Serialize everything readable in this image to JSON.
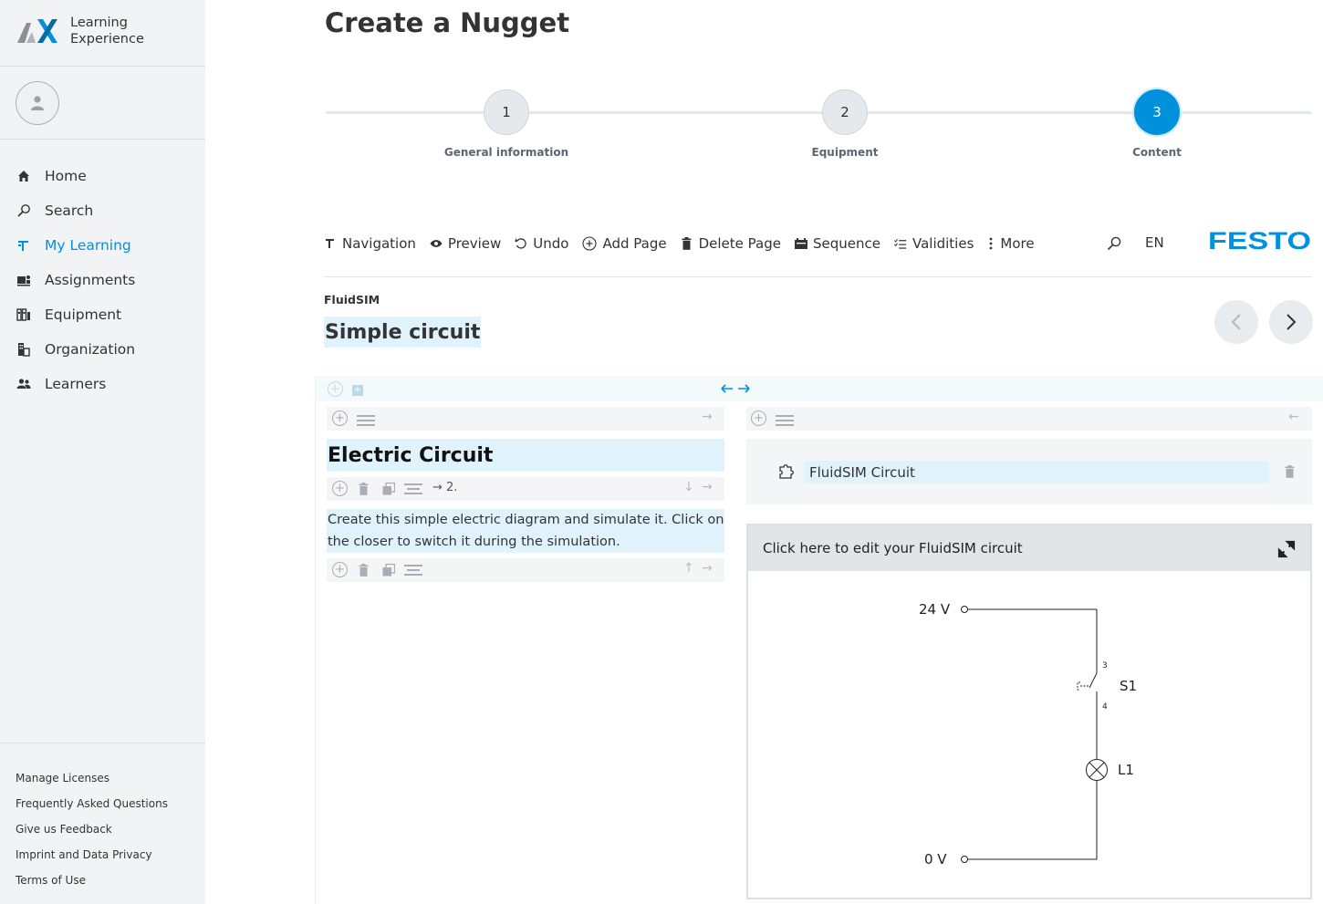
{
  "app": {
    "brand_line1": "Learning",
    "brand_line2": "Experience"
  },
  "nav": [
    {
      "label": "Home",
      "icon": "home-icon",
      "active": false
    },
    {
      "label": "Search",
      "icon": "search-icon",
      "active": false
    },
    {
      "label": "My Learning",
      "icon": "my-learning-icon",
      "active": true
    },
    {
      "label": "Assignments",
      "icon": "assignments-icon",
      "active": false
    },
    {
      "label": "Equipment",
      "icon": "equipment-icon",
      "active": false
    },
    {
      "label": "Organization",
      "icon": "organization-icon",
      "active": false
    },
    {
      "label": "Learners",
      "icon": "learners-icon",
      "active": false
    }
  ],
  "footer_links": [
    "Manage Licenses",
    "Frequently Asked Questions",
    "Give us Feedback",
    "Imprint and Data Privacy",
    "Terms of Use"
  ],
  "page": {
    "title": "Create a Nugget"
  },
  "steps": [
    {
      "number": "1",
      "label": "General information",
      "active": false
    },
    {
      "number": "2",
      "label": "Equipment",
      "active": false
    },
    {
      "number": "3",
      "label": "Content",
      "active": true
    }
  ],
  "toolbar": {
    "navigation": "Navigation",
    "preview": "Preview",
    "undo": "Undo",
    "add_page": "Add Page",
    "delete_page": "Delete Page",
    "sequence": "Sequence",
    "validities": "Validities",
    "more": "More",
    "language": "EN",
    "logo_text": "FESTO"
  },
  "nugget": {
    "breadcrumb": "FluidSIM",
    "title": "Simple circuit"
  },
  "left_column": {
    "heading": "Electric Circuit",
    "numbering": "→ 2.",
    "text": "Create this simple electric diagram and simulate it. Click on the closer to switch it during the simulation."
  },
  "right_column": {
    "component_name": "FluidSIM Circuit",
    "panel_header": "Click here to edit your FluidSIM circuit"
  },
  "circuit": {
    "top_voltage": "24 V",
    "bottom_voltage": "0 V",
    "switch_name": "S1",
    "switch_pin_top": "3",
    "switch_pin_bottom": "4",
    "lamp_name": "L1"
  },
  "colors": {
    "accent": "#0091dc",
    "highlight": "#e0f2fb",
    "sidebar_bg": "#f2f3f5"
  }
}
